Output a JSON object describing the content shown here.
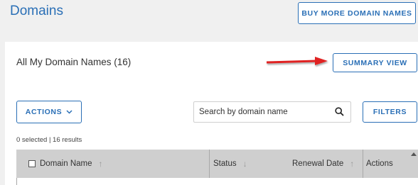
{
  "header": {
    "title": "Domains",
    "buy_button": "BUY MORE DOMAIN NAMES"
  },
  "card": {
    "title": "All My Domain Names (16)",
    "summary_button": "SUMMARY VIEW",
    "actions_button": "ACTIONS",
    "search_placeholder": "Search by domain name",
    "filters_button": "FILTERS",
    "results_text": "0 selected | 16 results"
  },
  "table": {
    "columns": [
      {
        "label": "Domain Name",
        "sortable": true,
        "sort_icon": "arrow-up-icon"
      },
      {
        "label": "Status",
        "sortable": true,
        "sort_icon": "arrow-down-icon"
      },
      {
        "label": "Renewal Date",
        "sortable": true,
        "sort_icon": "arrow-up-icon"
      },
      {
        "label": "Actions",
        "sortable": false
      }
    ]
  },
  "colors": {
    "accent": "#2a6fb6",
    "arrow": "#e02020",
    "header_bg": "#cfcfcf",
    "page_bg": "#f0f0f0"
  }
}
